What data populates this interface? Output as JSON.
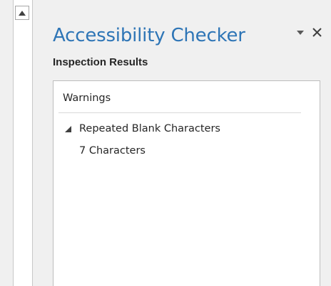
{
  "pane": {
    "title": "Accessibility Checker",
    "section_label": "Inspection Results"
  },
  "results": {
    "group": "Warnings",
    "issues": [
      {
        "label": "Repeated Blank Characters",
        "expanded": true,
        "children": [
          "7 Characters"
        ]
      }
    ]
  },
  "icons": {
    "scroll_up": "triangle-up-icon",
    "dropdown": "chevron-down-icon",
    "close": "close-icon",
    "expand": "triangle-expanded-icon"
  },
  "colors": {
    "title": "#2e75b6",
    "background": "#f0f0f0",
    "text": "#262626"
  }
}
